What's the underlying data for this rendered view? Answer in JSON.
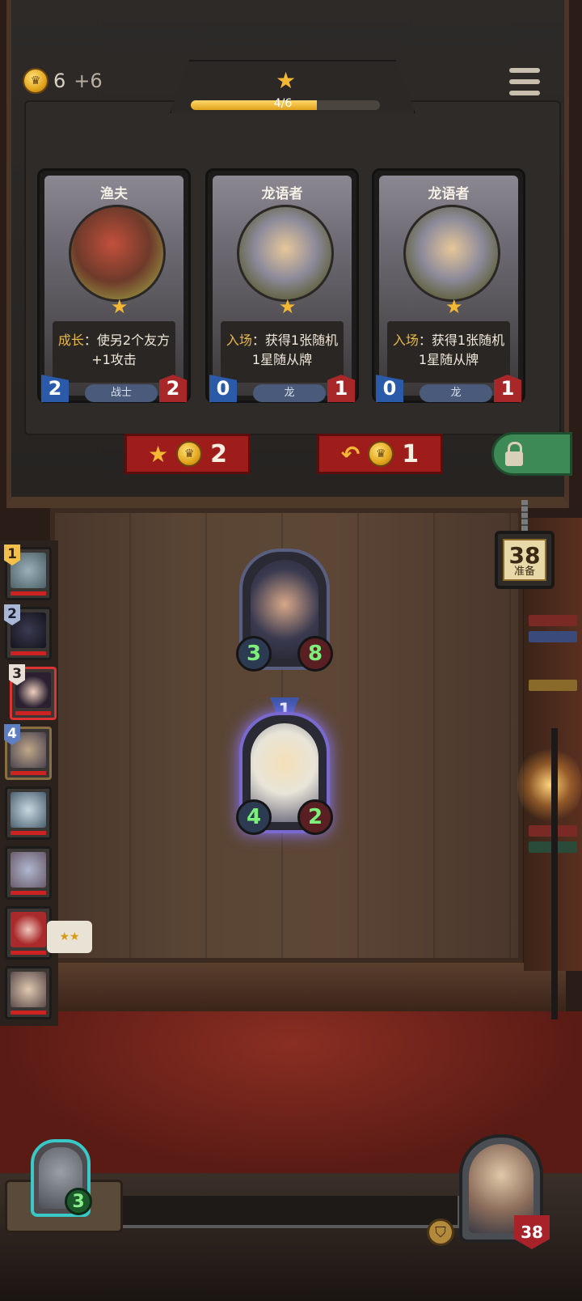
{
  "gold": {
    "current": "6",
    "income": "+6"
  },
  "tier": {
    "progress_text": "4/6",
    "progress": 0.667
  },
  "shop_cards": [
    {
      "name": "渔夫",
      "keyword": "成长",
      "text_line1": "：使另2个友方",
      "text_line2": "+1攻击",
      "attack": "2",
      "health": "2",
      "tribe": "战士"
    },
    {
      "name": "龙语者",
      "keyword": "入场",
      "text_line1": "：获得1张随机",
      "text_line2": "1星随从牌",
      "attack": "0",
      "health": "1",
      "tribe": "龙"
    },
    {
      "name": "龙语者",
      "keyword": "入场",
      "text_line1": "：获得1张随机",
      "text_line2": "1星随从牌",
      "attack": "0",
      "health": "1",
      "tribe": "龙"
    }
  ],
  "buttons": {
    "upgrade_cost": "2",
    "refresh_cost": "1"
  },
  "timer": {
    "value": "38",
    "label": "准备"
  },
  "players": [
    {
      "rank": "1"
    },
    {
      "rank": "2"
    },
    {
      "rank": "3"
    },
    {
      "rank": "4"
    }
  ],
  "player_tag": "★★",
  "board": [
    {
      "attack": "3",
      "health": "8"
    },
    {
      "attack": "4",
      "health": "2",
      "level": "1"
    }
  ],
  "hero_left": {
    "level": "3"
  },
  "hero_right": {
    "health": "38"
  },
  "colors": {
    "accent_gold": "#f4b832",
    "shop_button_red": "#9e1d1b",
    "lock_green": "#3e8a56"
  }
}
